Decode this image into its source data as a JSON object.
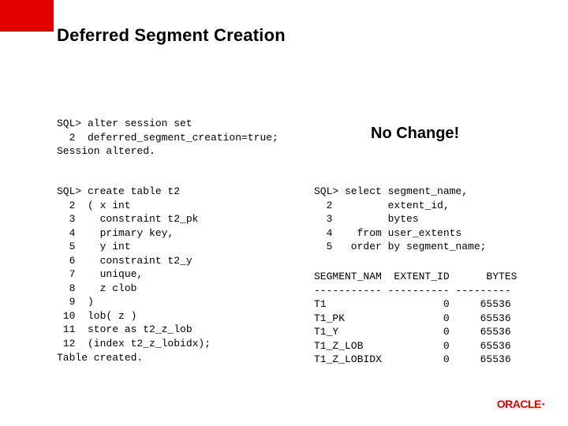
{
  "title": "Deferred Segment Creation",
  "callout": "No Change!",
  "code": {
    "alter": "SQL> alter session set\n  2  deferred_segment_creation=true;\nSession altered.",
    "create": "SQL> create table t2\n  2  ( x int\n  3    constraint t2_pk\n  4    primary key,\n  5    y int\n  6    constraint t2_y\n  7    unique,\n  8    z clob\n  9  )\n 10  lob( z )\n 11  store as t2_z_lob\n 12  (index t2_z_lobidx);\nTable created.",
    "select": "SQL> select segment_name,\n  2         extent_id,\n  3         bytes\n  4    from user_extents\n  5   order by segment_name;",
    "results": "SEGMENT_NAM  EXTENT_ID      BYTES\n----------- ---------- ---------\nT1                   0     65536\nT1_PK                0     65536\nT1_Y                 0     65536\nT1_Z_LOB             0     65536\nT1_Z_LOBIDX          0     65536"
  },
  "logo_text": "ORACLE"
}
